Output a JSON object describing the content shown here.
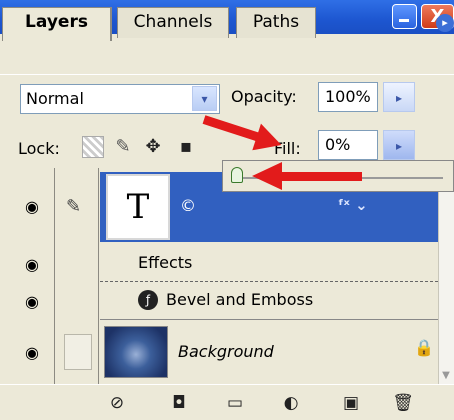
{
  "window": {
    "minimize_glyph": "",
    "close_glyph": "X"
  },
  "tabs": [
    {
      "label": "Layers",
      "active": true
    },
    {
      "label": "Channels",
      "active": false
    },
    {
      "label": "Paths",
      "active": false
    }
  ],
  "tab_menu_glyph": "▸",
  "blend": {
    "mode": "Normal",
    "arrow": "▾"
  },
  "opacity": {
    "label": "Opacity:",
    "value": "100%",
    "arrow": "▸"
  },
  "lock": {
    "label": "Lock:",
    "icons": [
      "lock-transparent-icon",
      "brush-icon",
      "move-icon",
      "lock-icon"
    ],
    "image_glyph": "✎",
    "position_glyph": "✥",
    "all_glyph": "▪"
  },
  "fill": {
    "label": "Fill:",
    "value": "0%",
    "arrow": "▸",
    "slider_fraction": 0.0
  },
  "layers": [
    {
      "type": "text",
      "thumb_text": "T",
      "extra": "©",
      "fx_glyph": "ᶠˣ ⌄",
      "selected": true
    },
    {
      "type": "effects",
      "label": "Effects"
    },
    {
      "type": "effect",
      "label": "Bevel and Emboss",
      "icon_glyph": "ƒ"
    },
    {
      "type": "image",
      "label": "Background",
      "lock_glyph": "🔒"
    }
  ],
  "eye_glyph": "◉",
  "bottom_icons": [
    {
      "name": "link-layers-icon",
      "glyph": "⊘"
    },
    {
      "name": "add-mask-icon",
      "glyph": "◘"
    },
    {
      "name": "new-group-icon",
      "glyph": "▭"
    },
    {
      "name": "adjustment-layer-icon",
      "glyph": "◐"
    },
    {
      "name": "new-layer-icon",
      "glyph": "▣"
    },
    {
      "name": "delete-layer-icon",
      "glyph": "🗑"
    }
  ],
  "colors": {
    "selection": "#3160c0",
    "annotation_arrow": "#e21b1b"
  }
}
